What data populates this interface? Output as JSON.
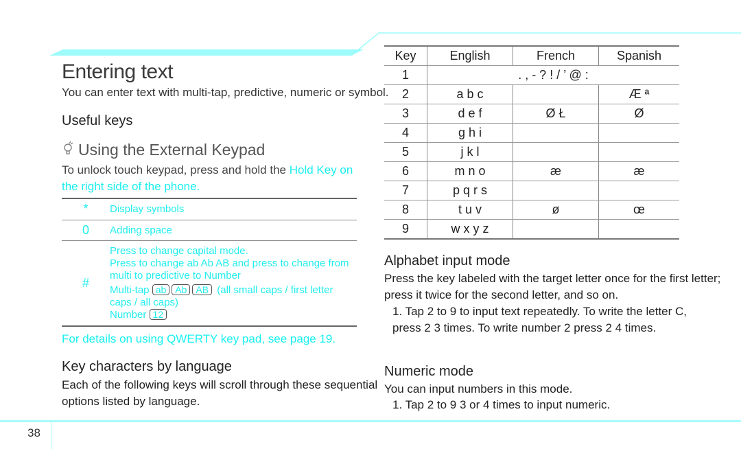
{
  "page": {
    "title": "Entering text",
    "intro": "You can enter text with multi-tap, predictive, numeric or symbol.",
    "page_number": "38",
    "accent_color": "#19f0f0"
  },
  "useful_keys": {
    "heading": "Useful keys",
    "tip": {
      "icon": "lightbulb-icon",
      "title": "Using the External Keypad",
      "body_prefix": "To unlock touch keypad, press and hold the ",
      "body_highlight": "Hold Key",
      "body_suffix": " on the right side of the phone."
    },
    "rows": [
      {
        "key": "*",
        "lines": [
          "Display symbols"
        ]
      },
      {
        "key": "0",
        "lines": [
          "Adding space"
        ]
      },
      {
        "key": "#",
        "lines": [
          "Press to change capital mode.",
          "Press to change ab Ab AB and press to change from",
          "multi to predictive to Number"
        ],
        "multitap_label": "Multi-tap",
        "multitap_badges": [
          "ab",
          "Ab",
          "AB"
        ],
        "multitap_desc": "(all small caps / first letter caps / all caps)",
        "number_label": "Number",
        "number_badge": "12"
      }
    ],
    "qwerty_note": "For details on using QWERTY key pad, see page 19."
  },
  "key_chars": {
    "heading": "Key characters by language",
    "body": "Each of the following keys will scroll through these sequential options listed by language.",
    "table": {
      "headers": [
        "Key",
        "English",
        "French",
        "Spanish"
      ],
      "row1": {
        "key": "1",
        "all": ". , - ? ! / ’ @ :"
      },
      "rows": [
        {
          "key": "2",
          "english": "a b c",
          "french": "",
          "spanish": "Æ  ª"
        },
        {
          "key": "3",
          "english": "d e f",
          "french": "Ø  Ł",
          "spanish": "Ø"
        },
        {
          "key": "4",
          "english": "g h i",
          "french": "",
          "spanish": ""
        },
        {
          "key": "5",
          "english": "j k l",
          "french": "",
          "spanish": ""
        },
        {
          "key": "6",
          "english": "m n o",
          "french": "æ",
          "spanish": "æ"
        },
        {
          "key": "7",
          "english": "p q r s",
          "french": "",
          "spanish": ""
        },
        {
          "key": "8",
          "english": "t u v",
          "french": "ø",
          "spanish": "œ"
        },
        {
          "key": "9",
          "english": "w x y z",
          "french": "",
          "spanish": ""
        }
      ]
    }
  },
  "alphabet_mode": {
    "heading": "Alphabet input mode",
    "body": "Press the key labeled with the target letter once for the first letter; press it twice for the second letter, and so on.",
    "step": "1. Tap 2 to 9 to input text repeatedly. To write the letter C, press 2 3 times. To write number 2 press 2 4 times."
  },
  "numeric_mode": {
    "heading": "Numeric mode",
    "body": "You can input numbers in this mode.",
    "step": "1. Tap 2 to 9 3 or 4 times to input numeric."
  }
}
